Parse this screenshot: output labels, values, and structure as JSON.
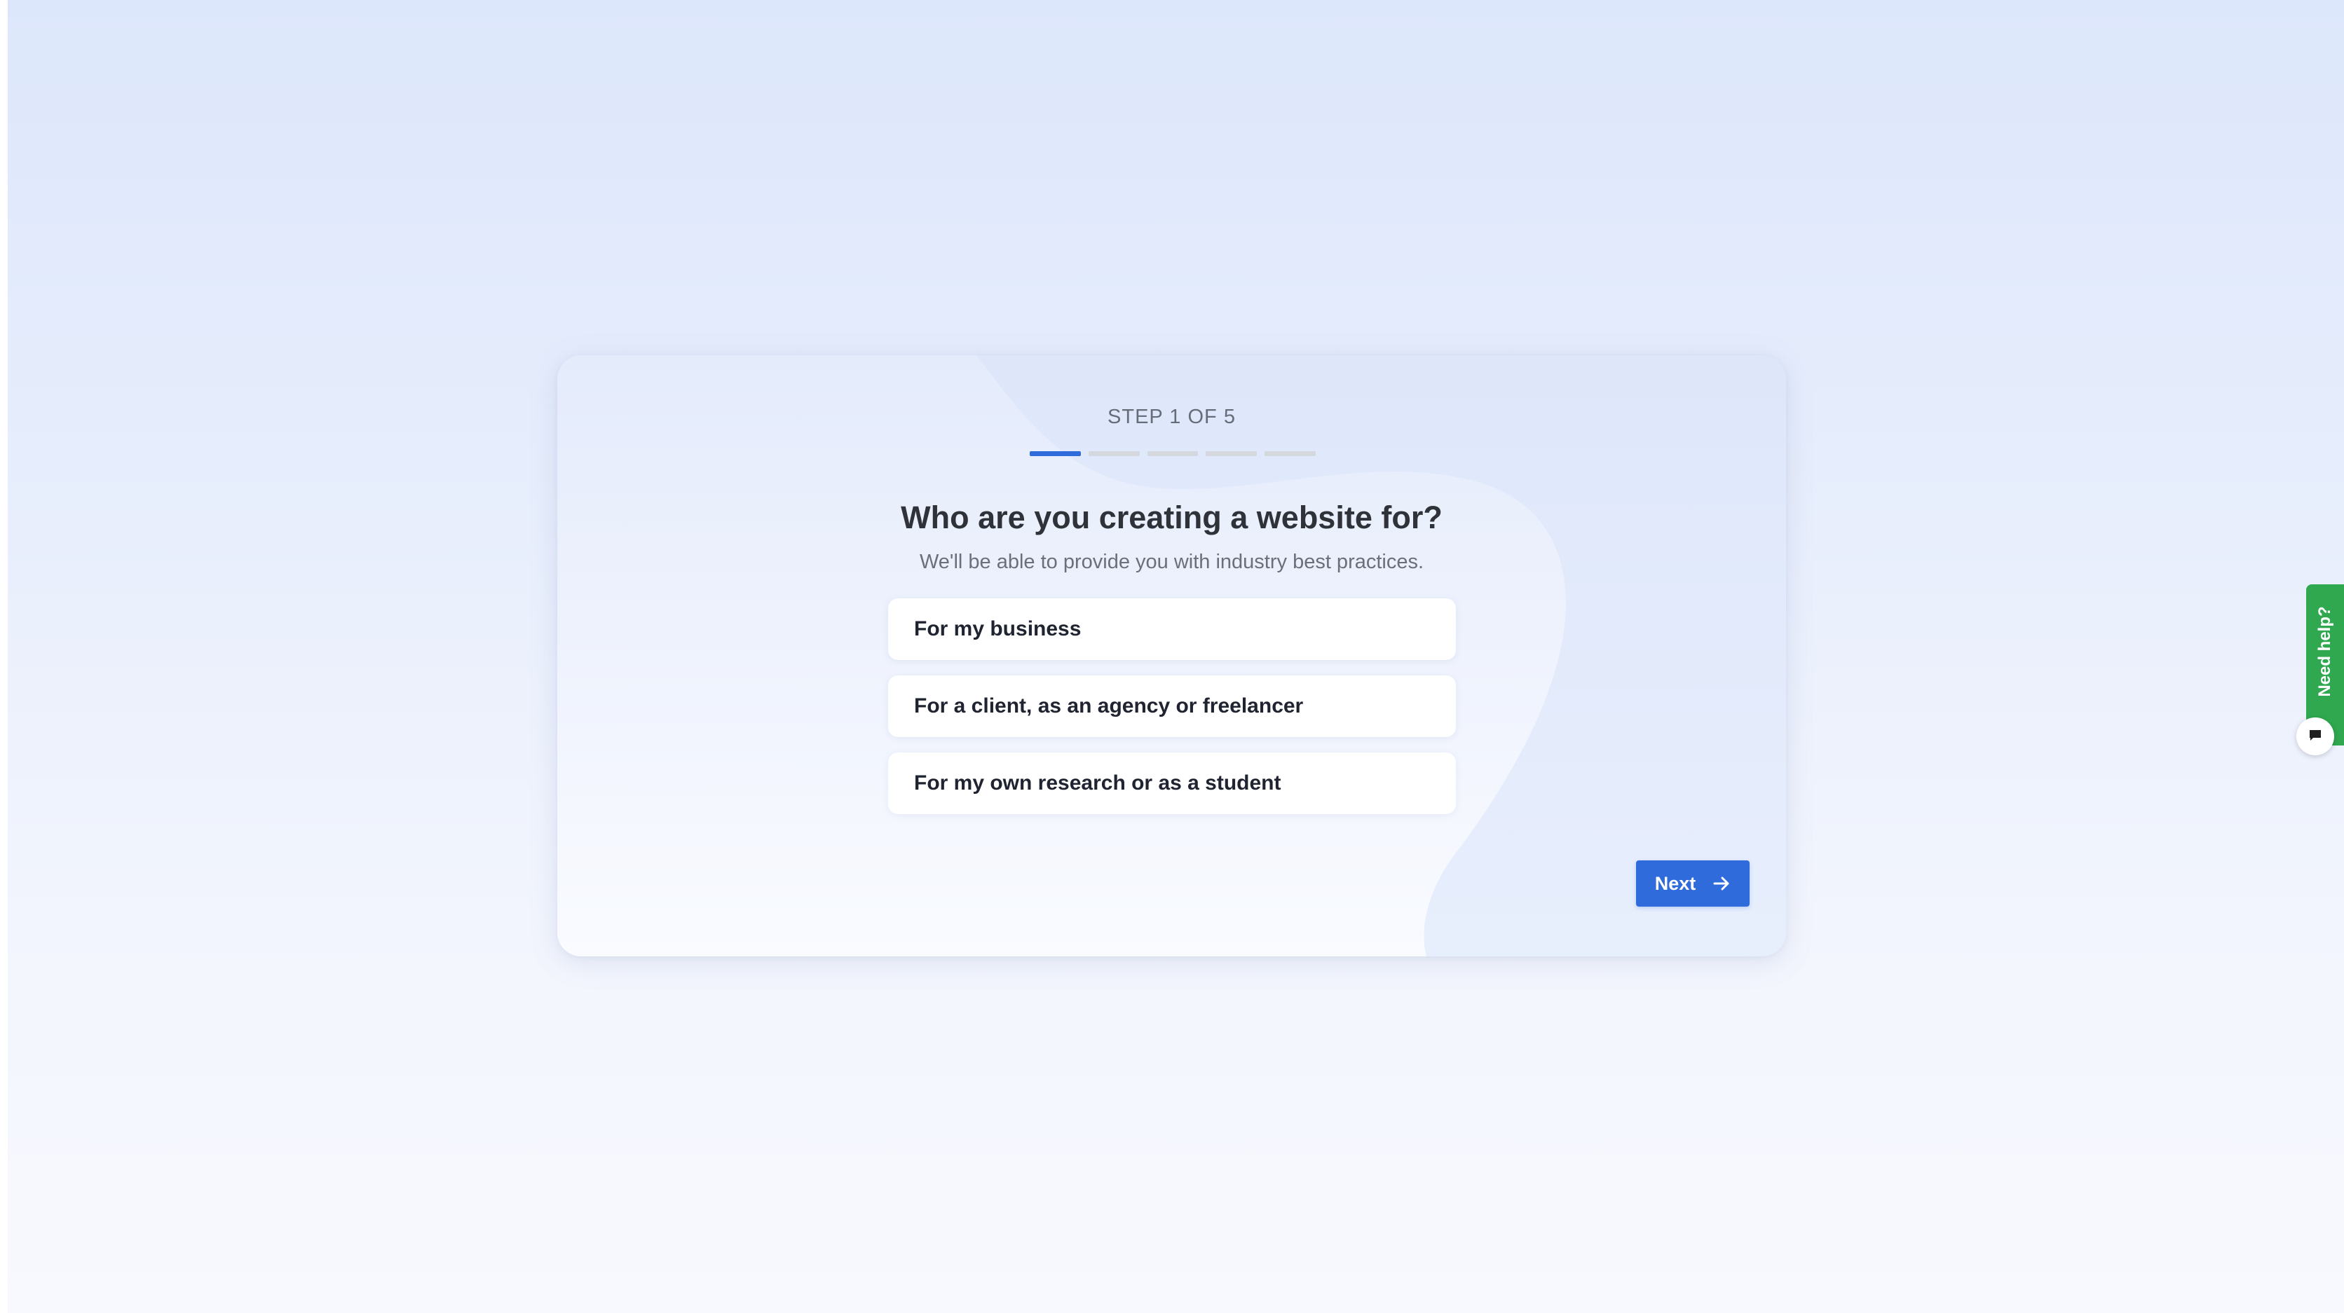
{
  "wizard": {
    "step_label": "STEP 1 OF 5",
    "current_step": 1,
    "total_steps": 5,
    "title": "Who are you creating a website for?",
    "subtitle": "We'll be able to provide you with industry best practices.",
    "options": [
      {
        "label": "For my business"
      },
      {
        "label": "For a client, as an agency or freelancer"
      },
      {
        "label": "For my own research or as a student"
      }
    ],
    "next_label": "Next"
  },
  "help_widget": {
    "label": "Need help?",
    "icon": "chat-icon"
  },
  "icons": {
    "next": "arrow-right-icon",
    "chat": "chat-icon"
  },
  "colors": {
    "accent": "#2f6bdb",
    "progress_inactive": "#d4d7de",
    "help_green": "#2fa84f",
    "title_text": "#2f3238"
  }
}
